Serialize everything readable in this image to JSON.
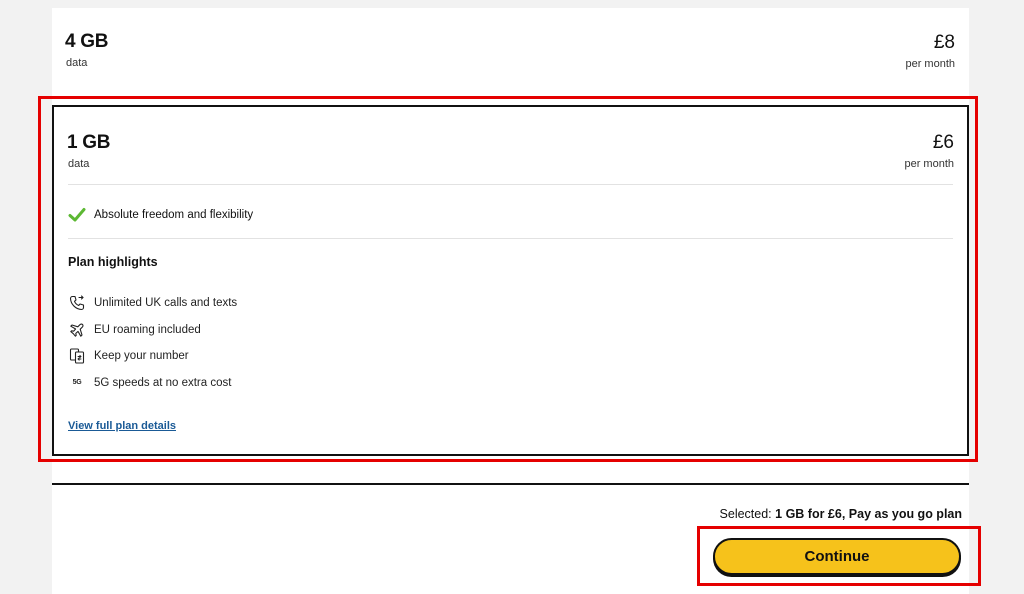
{
  "plans": [
    {
      "data_amount": "4 GB",
      "data_label": "data",
      "price": "£8",
      "period": "per month"
    },
    {
      "data_amount": "1 GB",
      "data_label": "data",
      "price": "£6",
      "period": "per month",
      "feature": "Absolute freedom and flexibility",
      "highlights_title": "Plan highlights",
      "highlights": [
        {
          "icon": "phone-icon",
          "text": "Unlimited UK calls and texts"
        },
        {
          "icon": "plane-icon",
          "text": "EU roaming included"
        },
        {
          "icon": "sim-swap-icon",
          "text": "Keep your number"
        },
        {
          "icon": "5g-icon",
          "text": "5G speeds at no extra cost",
          "badge": "5G"
        }
      ],
      "details_link": "View full plan details"
    }
  ],
  "footer": {
    "selected_prefix": "Selected:",
    "selected_value": "1 GB for £6, Pay as you go plan",
    "continue_label": "Continue"
  },
  "colors": {
    "accent_yellow": "#f6c21b",
    "highlight_red": "#e50000",
    "check_green": "#5cb833",
    "link_blue": "#1a5a96"
  }
}
